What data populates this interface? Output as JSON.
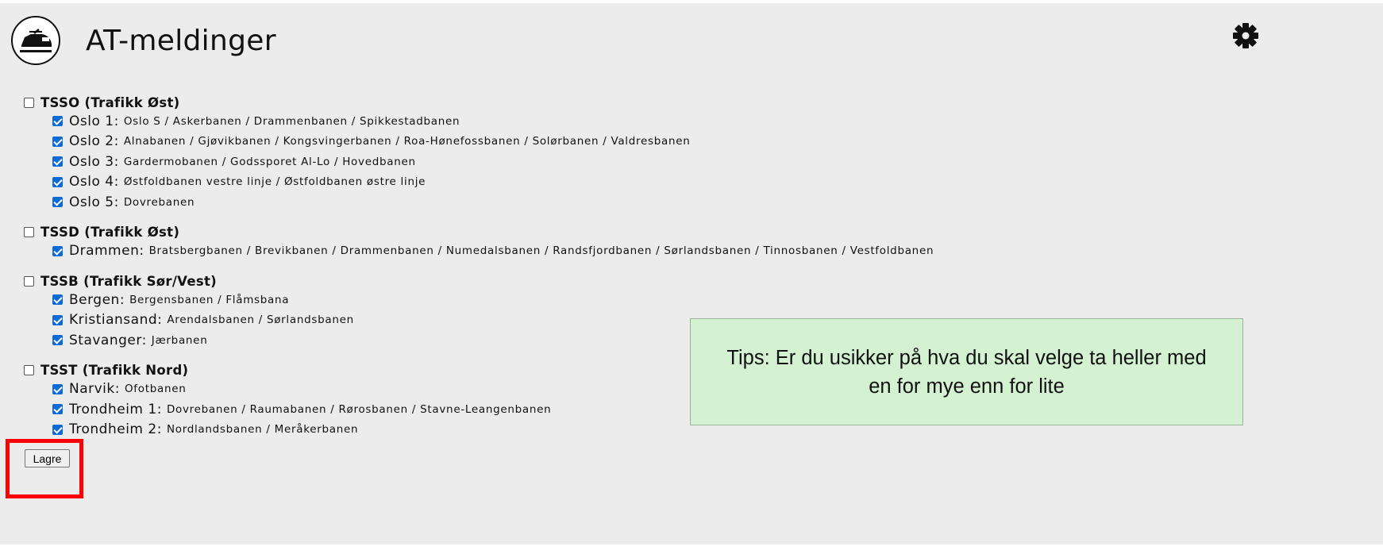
{
  "app": {
    "title": "AT-meldinger"
  },
  "icons": {
    "logo": "train-icon",
    "settings": "gear-icon"
  },
  "colors": {
    "accent": "#0b6bd3",
    "tip_bg": "#d4f2d2",
    "highlight": "#ff0000"
  },
  "groups": [
    {
      "label": "TSSO (Trafikk Øst)",
      "checked": false,
      "items": [
        {
          "name": "Oslo 1:",
          "lines": "Oslo S / Askerbanen / Drammenbanen / Spikkestadbanen",
          "checked": true
        },
        {
          "name": "Oslo 2:",
          "lines": "Alnabanen / Gjøvikbanen / Kongsvingerbanen / Roa-Hønefossbanen / Solørbanen / Valdresbanen",
          "checked": true
        },
        {
          "name": "Oslo 3:",
          "lines": "Gardermobanen / Godssporet Al-Lo / Hovedbanen",
          "checked": true
        },
        {
          "name": "Oslo 4:",
          "lines": "Østfoldbanen vestre linje / Østfoldbanen østre linje",
          "checked": true
        },
        {
          "name": "Oslo 5:",
          "lines": "Dovrebanen",
          "checked": true
        }
      ]
    },
    {
      "label": "TSSD (Trafikk Øst)",
      "checked": false,
      "items": [
        {
          "name": "Drammen:",
          "lines": "Bratsbergbanen / Brevikbanen / Drammenbanen / Numedalsbanen / Randsfjordbanen / Sørlandsbanen / Tinnosbanen / Vestfoldbanen",
          "checked": true
        }
      ]
    },
    {
      "label": "TSSB (Trafikk Sør/Vest)",
      "checked": false,
      "items": [
        {
          "name": "Bergen:",
          "lines": "Bergensbanen / Flåmsbana",
          "checked": true
        },
        {
          "name": "Kristiansand:",
          "lines": "Arendalsbanen / Sørlandsbanen",
          "checked": true
        },
        {
          "name": "Stavanger:",
          "lines": "Jærbanen",
          "checked": true
        }
      ]
    },
    {
      "label": "TSST (Trafikk Nord)",
      "checked": false,
      "items": [
        {
          "name": "Narvik:",
          "lines": "Ofotbanen",
          "checked": true
        },
        {
          "name": "Trondheim 1:",
          "lines": "Dovrebanen / Raumabanen / Rørosbanen / Stavne-Leangenbanen",
          "checked": true
        },
        {
          "name": "Trondheim 2:",
          "lines": "Nordlandsbanen / Meråkerbanen",
          "checked": true
        }
      ]
    }
  ],
  "tip": {
    "text": "Tips: Er du usikker på hva du skal velge ta heller med en for mye enn for lite"
  },
  "actions": {
    "save_label": "Lagre"
  }
}
